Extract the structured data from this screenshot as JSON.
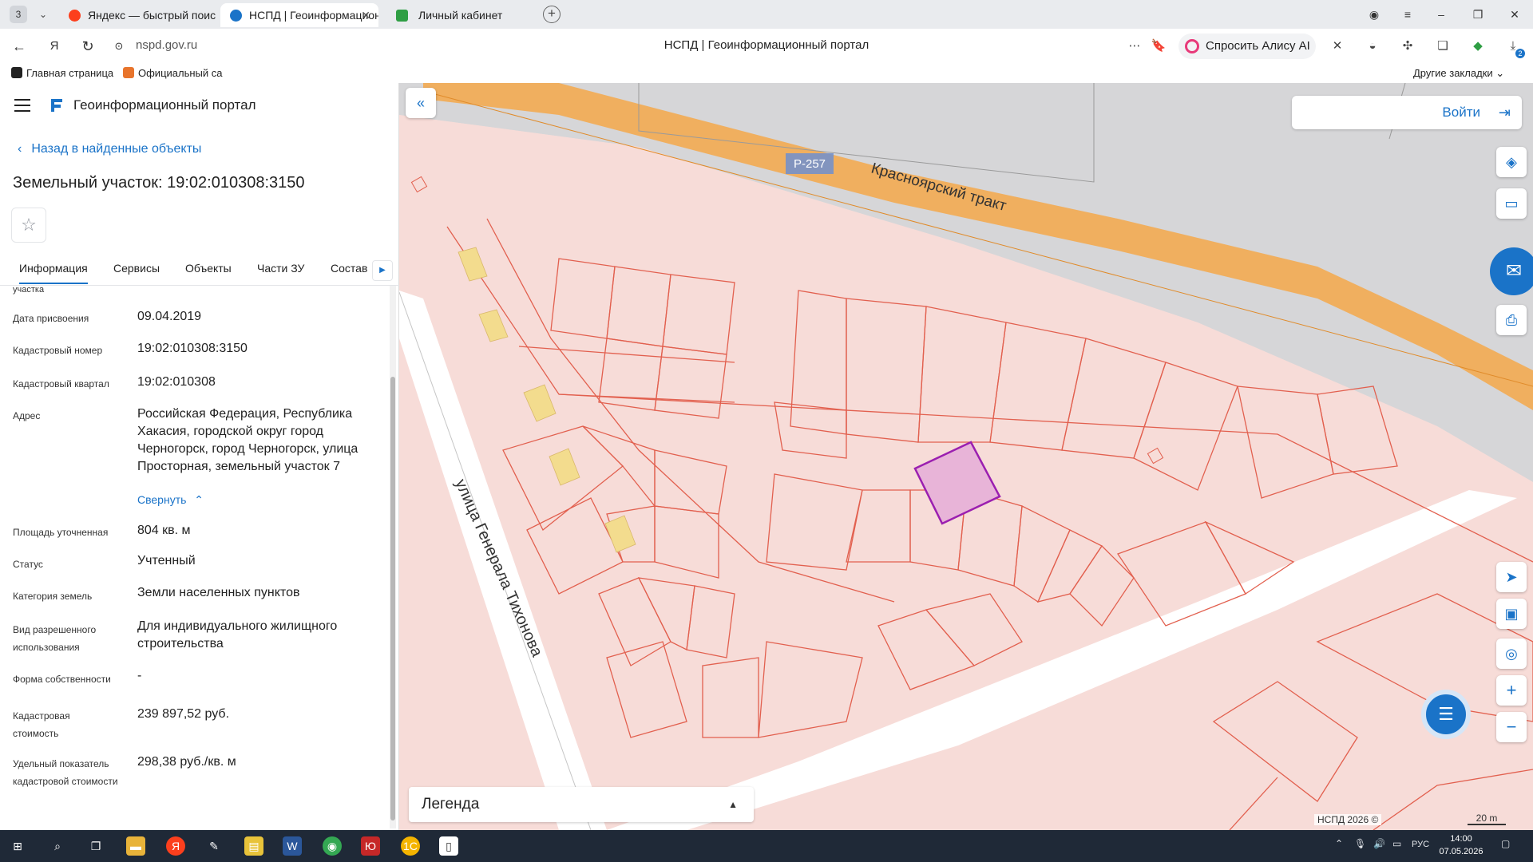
{
  "browser": {
    "tab_count": "3",
    "tabs": [
      {
        "label": "Яндекс — быстрый поиск",
        "fav_color": "#fc3f1d"
      },
      {
        "label": "НСПД | Геоинформационный портал",
        "fav_color": "#1a73c8"
      },
      {
        "label": "Личный кабинет",
        "fav_color": "#2f9e44"
      }
    ],
    "url": "nspd.gov.ru",
    "page_title": "НСПД | Геоинформационный портал",
    "alice_label": "Спросить Алису AI",
    "bookmarks": [
      {
        "label": "Главная страница"
      },
      {
        "label": "Официальный са"
      }
    ],
    "other_bookmarks": "Другие закладки",
    "downloads_badge": "2"
  },
  "panel": {
    "portal_name": "Геоинформационный портал",
    "back_link": "Назад в найденные объекты",
    "object_title": "Земельный участок: 19:02:010308:3150",
    "tabs": [
      "Информация",
      "Сервисы",
      "Объекты",
      "Части ЗУ",
      "Состав"
    ],
    "cut_label": "участка",
    "properties": [
      {
        "label": "Дата присвоения",
        "value": "09.04.2019"
      },
      {
        "label": "Кадастровый номер",
        "value": "19:02:010308:3150"
      },
      {
        "label": "Кадастровый квартал",
        "value": "19:02:010308"
      },
      {
        "label": "Адрес",
        "value": "Российская Федерация, Республика Хакасия, городской округ город Черногорск, город Черногорск, улица Просторная, земельный участок 7"
      },
      {
        "label": "Площадь уточненная",
        "value": "804 кв. м"
      },
      {
        "label": "Статус",
        "value": "Учтенный"
      },
      {
        "label": "Категория земель",
        "value": "Земли населенных пунктов"
      },
      {
        "label": "Вид разрешенного использования",
        "value": "Для индивидуального жилищного строительства"
      },
      {
        "label": "Форма собственности",
        "value": "-"
      },
      {
        "label": "Кадастровая стоимость",
        "value": "239 897,52 руб."
      },
      {
        "label": "Удельный показатель кадастровой стоимости",
        "value": "298,38 руб./кв. м"
      }
    ],
    "collapse_label": "Свернуть"
  },
  "map": {
    "login_label": "Войти",
    "legend_label": "Легенда",
    "road_badge": "Р-257",
    "road_name": "Красноярский тракт",
    "street_name": "улица Генерала Тихонова",
    "attribution": "НСПД 2026 ©",
    "scale": "20 m",
    "colors": {
      "parcel_fill": "#f7dcd8",
      "parcel_line": "#e2604f",
      "road_fill": "#f4a84a",
      "road_zone": "#d6d6d8",
      "selected": "#9b1fb0",
      "building": "#f3dc8e"
    }
  },
  "taskbar": {
    "language": "РУС",
    "time": "14:00",
    "date": "07.05.2026"
  }
}
